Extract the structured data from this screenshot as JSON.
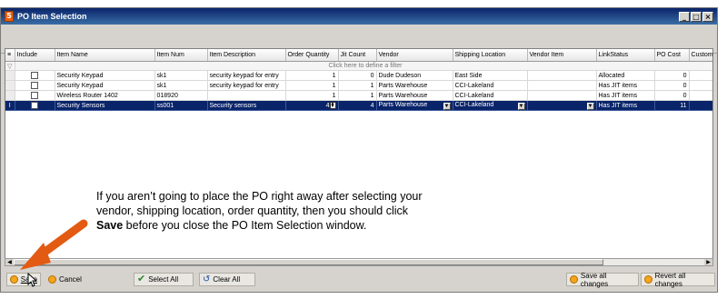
{
  "window": {
    "title": "PO Item Selection",
    "app_icon_glyph": "5",
    "controls": [
      "_",
      "□",
      "×"
    ]
  },
  "grid": {
    "columns": [
      "Include",
      "Item Name",
      "Item Num",
      "Item Description",
      "Order Quantity",
      "Jit Count",
      "Vendor",
      "Shipping Location",
      "Vendor Item",
      "LinkStatus",
      "PO Cost",
      "Custom"
    ],
    "filter_placeholder": "Click here to define a filter",
    "rows": [
      {
        "include": false,
        "item_name": "Security Keypad",
        "item_num": "sk1",
        "item_description": "security keypad for entry",
        "order_quantity": "1",
        "jit_count": "0",
        "vendor": "Dude Dudeson",
        "shipping_location": "East Side",
        "vendor_item": "",
        "link_status": "Allocated",
        "po_cost": "0",
        "custom": "",
        "selected": false
      },
      {
        "include": false,
        "item_name": "Security Keypad",
        "item_num": "sk1",
        "item_description": "security keypad for entry",
        "order_quantity": "1",
        "jit_count": "1",
        "vendor": "Parts Warehouse",
        "shipping_location": "CCI-Lakeland",
        "vendor_item": "",
        "link_status": "Has JIT items",
        "po_cost": "0",
        "custom": "",
        "selected": false
      },
      {
        "include": false,
        "item_name": "Wireless Router 1402",
        "item_num": "018920",
        "item_description": "",
        "order_quantity": "1",
        "jit_count": "1",
        "vendor": "Parts Warehouse",
        "shipping_location": "CCI-Lakeland",
        "vendor_item": "",
        "link_status": "Has JIT items",
        "po_cost": "0",
        "custom": "",
        "selected": false
      },
      {
        "include": false,
        "item_name": "Security Sensors",
        "item_num": "ss001",
        "item_description": "Security sensors",
        "order_quantity": "4",
        "jit_count": "4",
        "vendor": "Parts Warehouse",
        "shipping_location": "CCI-Lakeland",
        "vendor_item": "",
        "link_status": "Has JIT items",
        "po_cost": "11",
        "custom": "",
        "selected": true
      }
    ]
  },
  "buttons": {
    "save": "Save",
    "cancel": "Cancel",
    "select_all": "Select All",
    "clear_all": "Clear All",
    "save_all_changes": "Save all changes",
    "revert_all_changes": "Revert all changes"
  },
  "annotation": {
    "line1": "If you aren’t going to place the PO right away after selecting your",
    "line2": "vendor, shipping location, order quantity, then you should click",
    "line3_bold": "Save",
    "line3_rest": " before you close the PO Item Selection window."
  },
  "colors": {
    "arrow": "#e35a12",
    "selected_row": "#0a246a",
    "titlebar": "#0a246a"
  }
}
